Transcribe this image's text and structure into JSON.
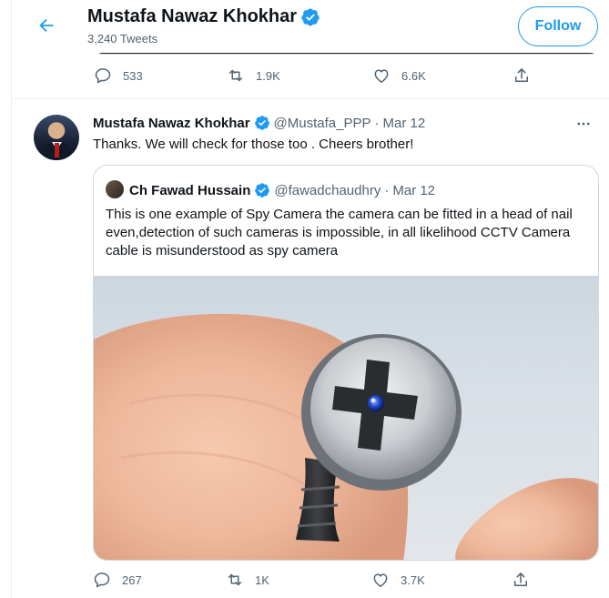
{
  "header": {
    "name": "Mustafa Nawaz Khokhar",
    "tweet_count": "3,240 Tweets",
    "follow_label": "Follow"
  },
  "prev_tweet": {
    "replies": "533",
    "retweets": "1.9K",
    "likes": "6.6K"
  },
  "tweet": {
    "author_name": "Mustafa Nawaz Khokhar",
    "handle": "@Mustafa_PPP",
    "dot": "·",
    "date": "Mar 12",
    "text": "Thanks. We will check for those too . Cheers brother!",
    "replies": "267",
    "retweets": "1K",
    "likes": "3.7K",
    "quoted": {
      "author_name": "Ch Fawad Hussain",
      "handle": "@fawadchaudhry",
      "dot": "·",
      "date": "Mar 12",
      "text": "This is one example of Spy Camera the camera can be fitted in a head of nail even,detection of such cameras is impossible, in all likelihood CCTV Camera cable is misunderstood as spy camera"
    }
  },
  "colors": {
    "accent": "#1d9bf0",
    "text_primary": "#0f1419",
    "text_secondary": "#536471",
    "border": "#cfd9de"
  },
  "icons": [
    "back-arrow-icon",
    "verified-badge-icon",
    "reply-icon",
    "retweet-icon",
    "like-icon",
    "share-icon",
    "more-icon"
  ]
}
